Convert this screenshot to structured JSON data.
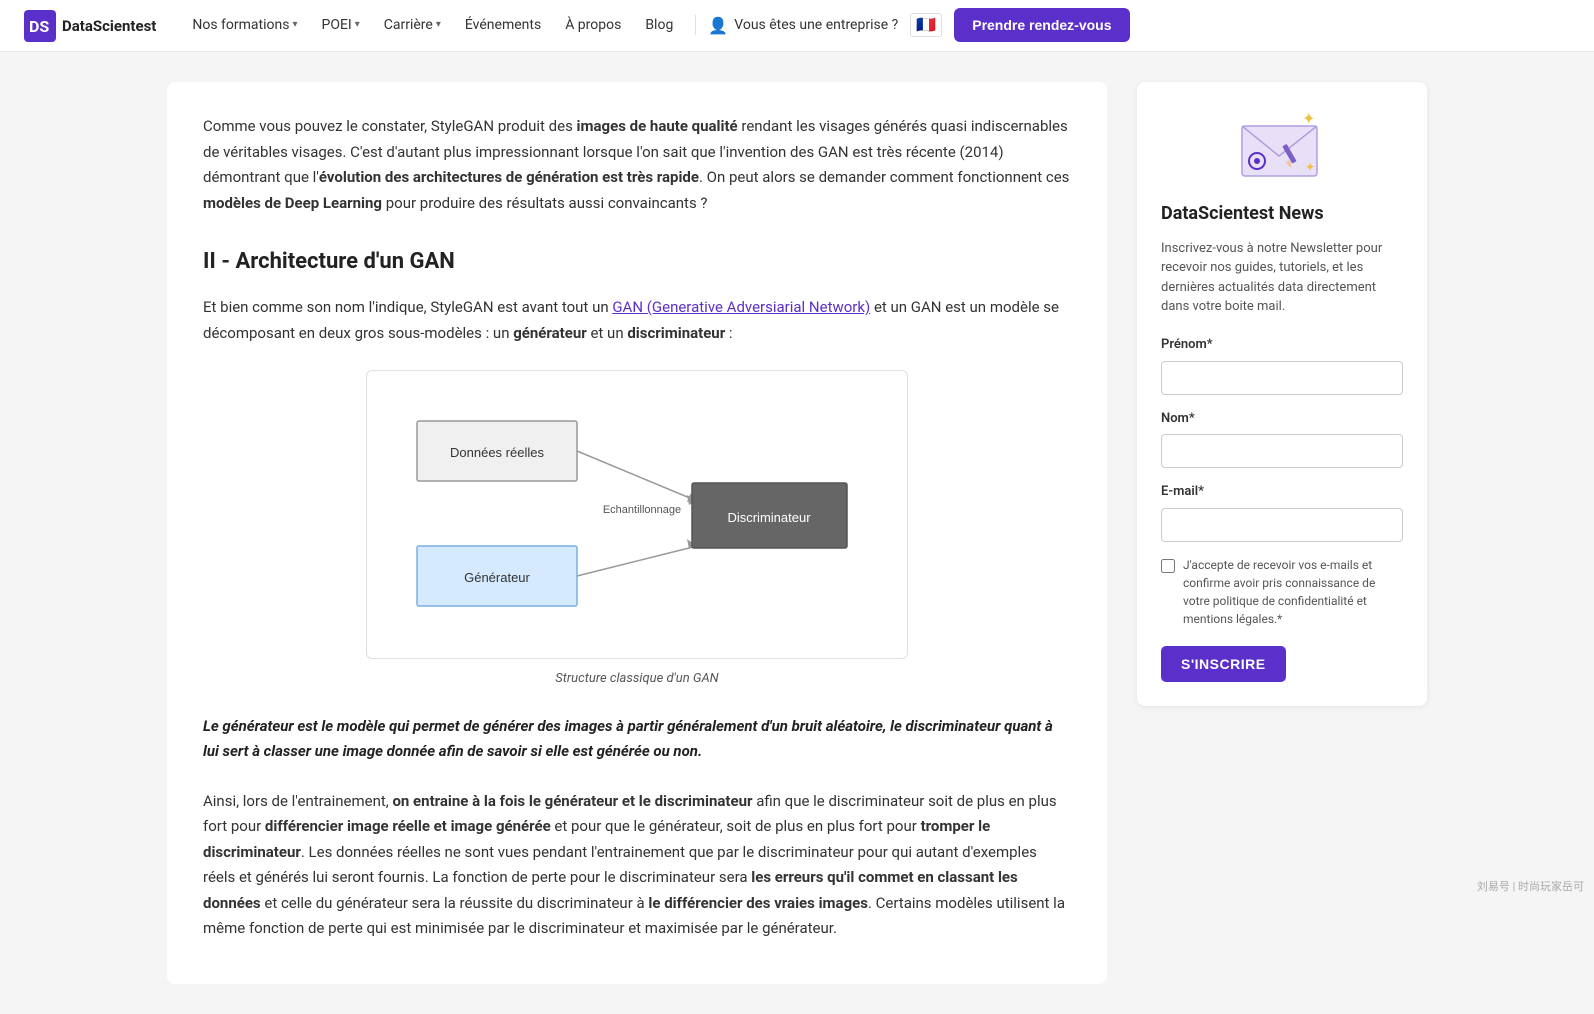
{
  "navbar": {
    "logo_text": "DataScientest",
    "nav_items": [
      {
        "label": "Nos formations",
        "has_chevron": true
      },
      {
        "label": "POEI",
        "has_chevron": true
      },
      {
        "label": "Carrière",
        "has_chevron": true
      },
      {
        "label": "Événements",
        "has_chevron": false
      },
      {
        "label": "À propos",
        "has_chevron": false
      },
      {
        "label": "Blog",
        "has_chevron": false
      }
    ],
    "enterprise_label": "Vous êtes une entreprise ?",
    "cta_label": "Prendre rendez-vous"
  },
  "article": {
    "intro_p1": "Comme vous pouvez le constater, StyleGAN produit des ",
    "intro_bold1": "images de haute qualité",
    "intro_p2": " rendant les visages générés quasi indiscernables de véritables visages. C'est d'autant plus impressionnant lorsque l'on sait que l'invention des GAN est très récente (2014) démontrant que l'",
    "intro_bold2": "évolution des architectures de génération est très rapide",
    "intro_p3": ". On peut alors se demander comment fonctionnent ces ",
    "intro_bold3": "modèles de Deep Learning",
    "intro_p4": " pour produire des résultats aussi convaincants ?",
    "section_title": "II - Architecture d'un GAN",
    "section_intro_p1": "Et bien comme son nom l'indique, StyleGAN est avant tout un ",
    "section_intro_link": "GAN (Generative Adversiarial Network)",
    "section_intro_p2": " et un GAN est un modèle se décomposant en deux gros sous-modèles : un ",
    "section_intro_bold1": "générateur",
    "section_intro_p3": " et un ",
    "section_intro_bold2": "discriminateur",
    "section_intro_p4": " :",
    "diagram_caption": "Structure classique d'un GAN",
    "diagram_label_donnees": "Données réelles",
    "diagram_label_generateur": "Générateur",
    "diagram_label_echantillonnage": "Echantillonnage",
    "diagram_label_discriminateur": "Discriminateur",
    "blockquote": "Le générateur est le modèle qui permet de générer des images à partir généralement d'un bruit aléatoire, le discriminateur quant à lui sert à classer une image donnée afin de savoir si elle est générée ou non.",
    "body_p1_pre": "Ainsi, lors de l'entrainement, ",
    "body_p1_bold": "on entraine à la fois le générateur et le discriminateur",
    "body_p1_mid": " afin que le discriminateur soit de plus en plus fort pour ",
    "body_p1_bold2": "différencier image réelle et image générée",
    "body_p1_mid2": " et pour que le générateur, soit de plus en plus fort pour ",
    "body_p1_bold3": "tromper le discriminateur",
    "body_p1_post": ". Les données réelles ne sont vues pendant l'entrainement que par le discriminateur pour qui autant d'exemples réels et générés lui seront fournis. La fonction de perte pour le discriminateur sera ",
    "body_p1_bold4": "les erreurs qu'il commet en classant les données",
    "body_p1_mid3": " et celle du générateur sera la réussite du discriminateur à ",
    "body_p1_bold5": "le différencier des vraies images",
    "body_p1_end": ". Certains modèles utilisent la même fonction de perte qui est minimisée par le discriminateur et maximisée par le générateur."
  },
  "sidebar": {
    "title": "DataScientest News",
    "description": "Inscrivez-vous à notre Newsletter pour recevoir nos guides, tutoriels, et les dernières actualités data directement dans votre boite mail.",
    "prenom_label": "Prénom*",
    "prenom_placeholder": "",
    "nom_label": "Nom*",
    "nom_placeholder": "",
    "email_label": "E-mail*",
    "email_placeholder": "",
    "checkbox_text": "J'accepte de recevoir vos e-mails et confirme avoir pris connaissance de votre politique de confidentialité et mentions légales.*",
    "subscribe_btn": "S'INSCRIRE"
  },
  "watermark": "刘易号 | 时尚玩家岳可"
}
